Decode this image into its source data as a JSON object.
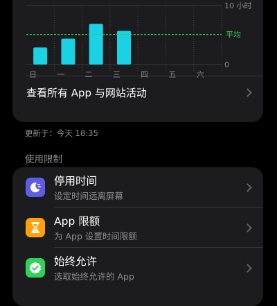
{
  "chart_data": {
    "type": "bar",
    "categories": [
      "日",
      "一",
      "二",
      "三",
      "四",
      "五",
      "六"
    ],
    "values": [
      2.9,
      4.4,
      6.9,
      5.7,
      null,
      null,
      null
    ],
    "average": 5.1,
    "ylim": [
      0,
      10
    ],
    "y_tick_labels": [
      "10 小时",
      "0"
    ],
    "average_label": "平均",
    "bar_color": "#19d2e6",
    "average_color": "#34c759",
    "grid": true
  },
  "activity": {
    "see_all_label": "查看所有 App 与网站活动",
    "updated_text": "更新于：今天 18:35"
  },
  "limits": {
    "header": "使用限制",
    "items": [
      {
        "title": "停用时间",
        "subtitle": "设定时间远离屏幕",
        "icon": "downtime-icon",
        "color": "#5e5ce6"
      },
      {
        "title": "App 限额",
        "subtitle": "为 App 设置时间限额",
        "icon": "hourglass-icon",
        "color": "#ff9f0a"
      },
      {
        "title": "始终允许",
        "subtitle": "选取始终允许的 App",
        "icon": "checkmark-badge-icon",
        "color": "#30d158"
      }
    ]
  }
}
